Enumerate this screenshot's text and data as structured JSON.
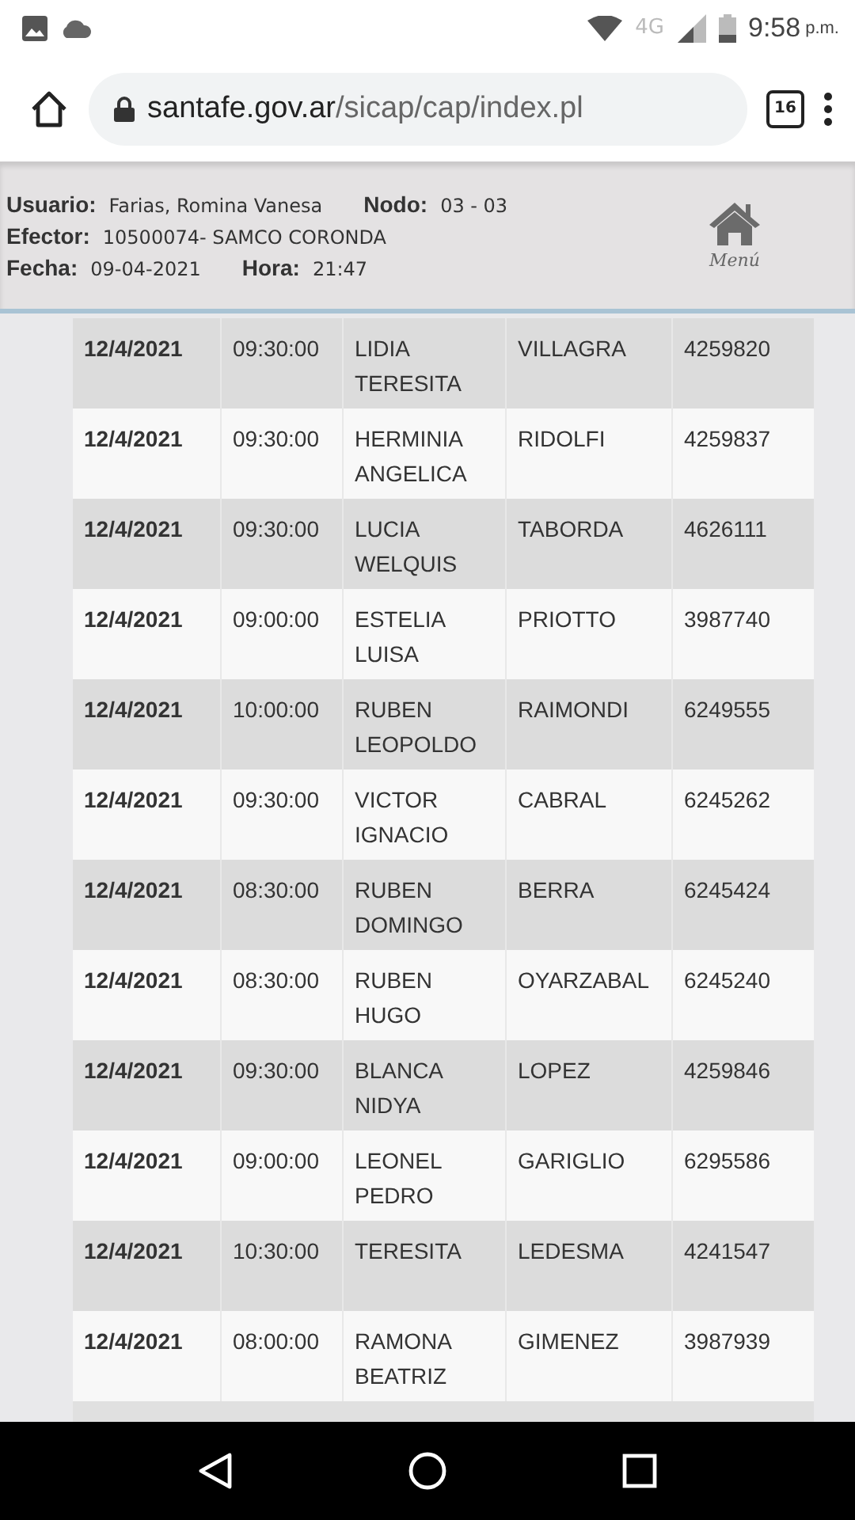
{
  "status_bar": {
    "network": "4G",
    "time": "9:58",
    "time_suffix": "p.m."
  },
  "browser": {
    "url_host": "santafe.gov.ar",
    "url_path": "/sicap/cap/index.pl",
    "tab_count": "16"
  },
  "header": {
    "lines": [
      [
        {
          "label": "Usuario:",
          "value": "Farias, Romina Vanesa"
        },
        {
          "label": "Nodo:",
          "value": "03 - 03"
        }
      ],
      [
        {
          "label": "Efector:",
          "value": "10500074- SAMCO CORONDA"
        }
      ],
      [
        {
          "label": "Fecha:",
          "value": "09-04-2021"
        },
        {
          "label": "Hora:",
          "value": "21:47"
        }
      ]
    ],
    "menu_label": "Menú"
  },
  "rows": [
    {
      "cells": [
        "12/4/2021",
        "09:30:00",
        "LIDIA TERESITA",
        "VILLAGRA",
        "4259820"
      ]
    },
    {
      "cells": [
        "12/4/2021",
        "09:30:00",
        "HERMINIA ANGELICA",
        "RIDOLFI",
        "4259837"
      ]
    },
    {
      "cells": [
        "12/4/2021",
        "09:30:00",
        "LUCIA WELQUIS",
        "TABORDA",
        "4626111"
      ]
    },
    {
      "cells": [
        "12/4/2021",
        "09:00:00",
        "ESTELIA LUISA",
        "PRIOTTO",
        "3987740"
      ]
    },
    {
      "cells": [
        "12/4/2021",
        "10:00:00",
        "RUBEN LEOPOLDO",
        "RAIMONDI",
        "6249555"
      ]
    },
    {
      "cells": [
        "12/4/2021",
        "09:30:00",
        "VICTOR IGNACIO",
        "CABRAL",
        "6245262"
      ]
    },
    {
      "cells": [
        "12/4/2021",
        "08:30:00",
        "RUBEN DOMINGO",
        "BERRA",
        "6245424"
      ]
    },
    {
      "cells": [
        "12/4/2021",
        "08:30:00",
        "RUBEN HUGO",
        "OYARZABAL",
        "6245240"
      ]
    },
    {
      "cells": [
        "12/4/2021",
        "09:30:00",
        "BLANCA NIDYA",
        "LOPEZ",
        "4259846"
      ]
    },
    {
      "cells": [
        "12/4/2021",
        "09:00:00",
        "LEONEL PEDRO",
        "GARIGLIO",
        "6295586"
      ]
    },
    {
      "cells": [
        "12/4/2021",
        "10:30:00",
        "TERESITA",
        "LEDESMA",
        "4241547"
      ]
    },
    {
      "cells": [
        "12/4/2021",
        "08:00:00",
        "RAMONA BEATRIZ",
        "GIMENEZ",
        "3987939"
      ]
    }
  ]
}
